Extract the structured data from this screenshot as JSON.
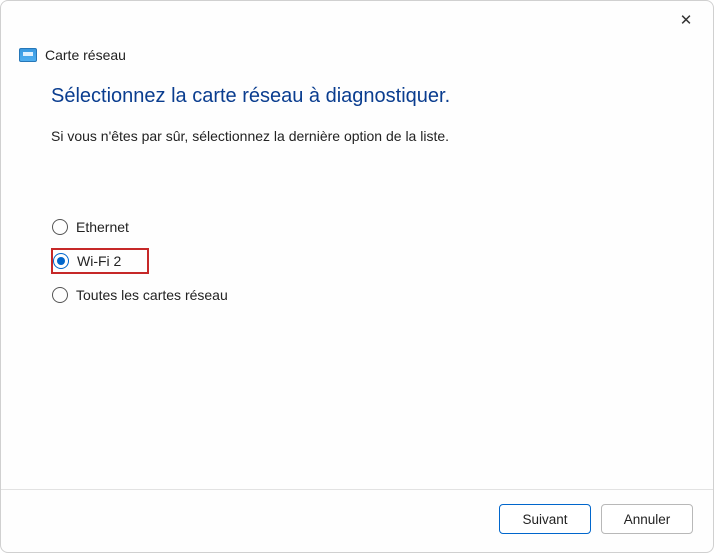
{
  "window": {
    "title": "Carte réseau"
  },
  "heading": "Sélectionnez la carte réseau à diagnostiquer.",
  "subtext": "Si vous n'êtes par sûr, sélectionnez la dernière option de la liste.",
  "options": [
    {
      "label": "Ethernet",
      "selected": false,
      "highlighted": false
    },
    {
      "label": "Wi-Fi 2",
      "selected": true,
      "highlighted": true
    },
    {
      "label": "Toutes les cartes réseau",
      "selected": false,
      "highlighted": false
    }
  ],
  "buttons": {
    "next": "Suivant",
    "cancel": "Annuler"
  }
}
